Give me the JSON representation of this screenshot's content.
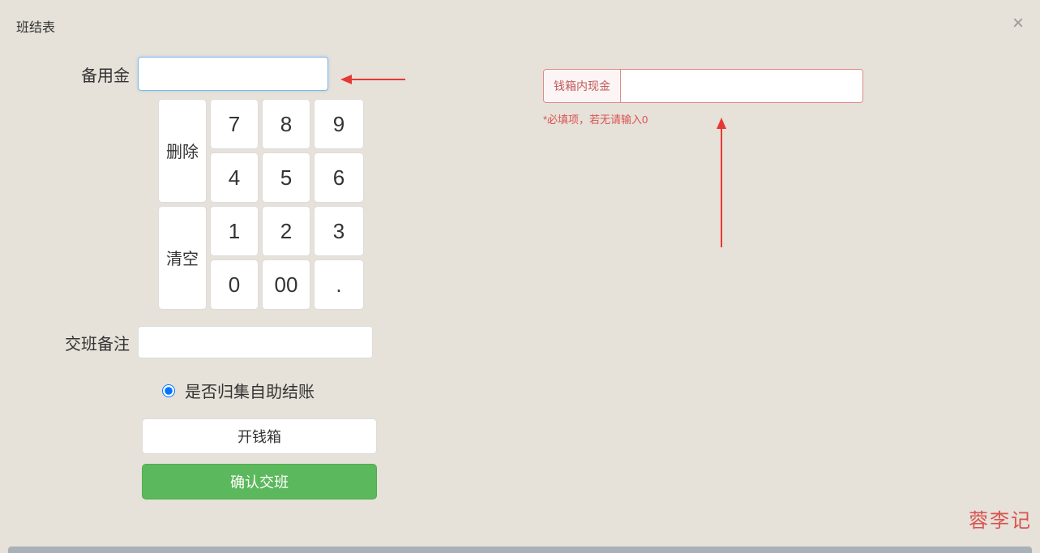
{
  "title": "班结表",
  "close_label": "×",
  "left": {
    "reserve_label": "备用金",
    "reserve_value": "",
    "keypad": {
      "k7": "7",
      "k8": "8",
      "k9": "9",
      "k4": "4",
      "k5": "5",
      "k6": "6",
      "k1": "1",
      "k2": "2",
      "k3": "3",
      "k0": "0",
      "k00": "00",
      "kdot": ".",
      "delete": "删除",
      "clear": "清空"
    },
    "remark_label": "交班备注",
    "remark_value": "",
    "radio_label": "是否归集自助结账",
    "open_drawer": "开钱箱",
    "confirm": "确认交班"
  },
  "right": {
    "cashbox_label": "钱箱内现金",
    "cashbox_value": "",
    "hint": "*必填项，若无请输入0"
  },
  "watermark": "蓉李记"
}
